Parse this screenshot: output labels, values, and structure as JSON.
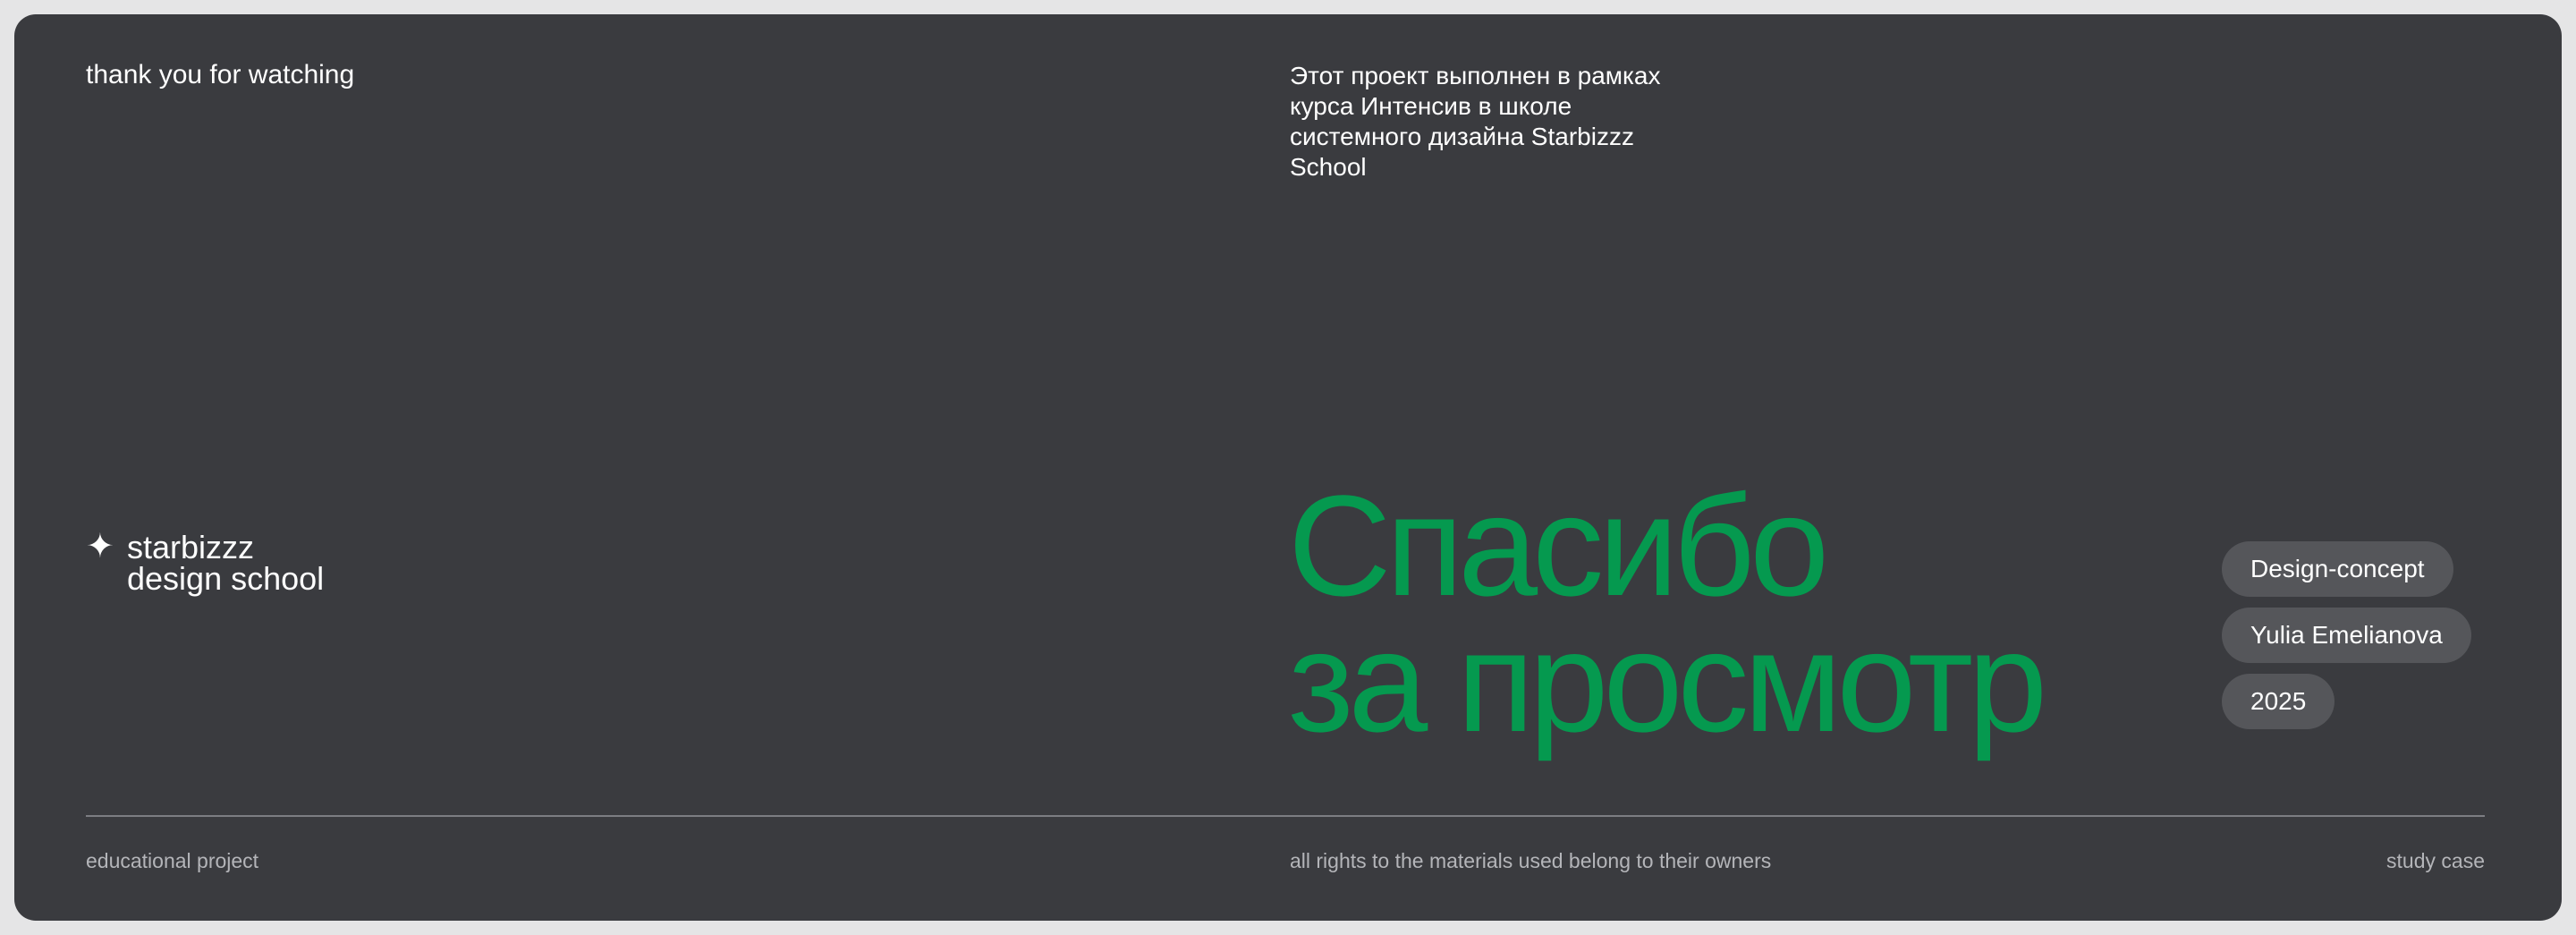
{
  "header": {
    "left_text": "thank you for watching",
    "right_text": "Этот проект выполнен в рамках курса Интенсив в школе системного дизайна Starbizzz School"
  },
  "logo": {
    "icon": "four-point-star-icon",
    "line1": "starbizzz",
    "line2": "design school"
  },
  "headline": {
    "line1": "Спасибо",
    "line2": "за просмотр"
  },
  "tags": [
    {
      "label": "Design-concept"
    },
    {
      "label": "Yulia Emelianova"
    },
    {
      "label": "2025"
    }
  ],
  "footer": {
    "left": "educational project",
    "center": "all rights to the materials used belong to their owners",
    "right": "study case"
  },
  "colors": {
    "background": "#3a3b3f",
    "accent": "#05994f",
    "tag_background": "#55565a"
  }
}
